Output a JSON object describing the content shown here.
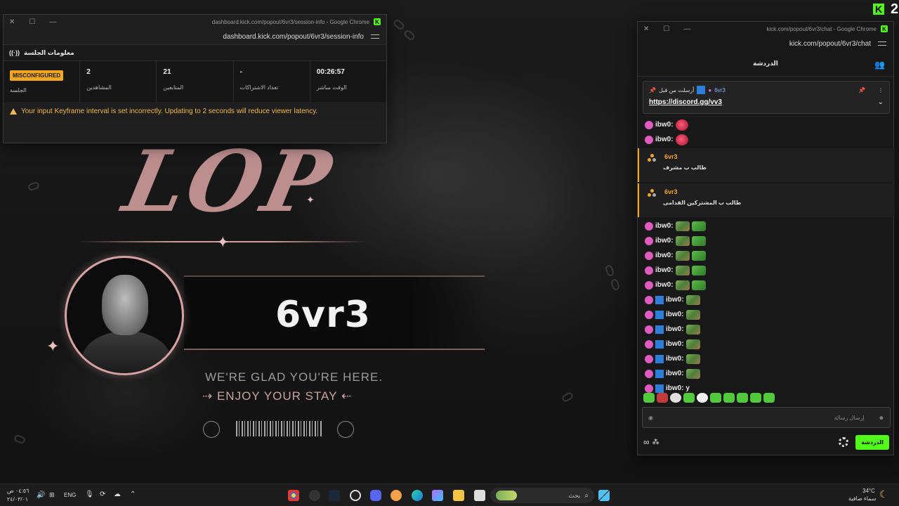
{
  "overlay": {
    "logo_text": "LOP",
    "streamer_name": "6vr3",
    "glad_text": "WE'RE GLAD YOU'RE HERE.",
    "enjoy_text": "ENJOY YOUR STAY"
  },
  "session_window": {
    "title": "dashboard.kick.com/popout/6vr3/session-info - Google Chrome",
    "url": "dashboard.kick.com/popout/6vr3/session-info",
    "header": "معلومات الجلسة",
    "stats": [
      {
        "value": "MISCONFIGURED",
        "label": "الجلسة",
        "is_badge": true
      },
      {
        "value": "2",
        "label": "المشاهدين"
      },
      {
        "value": "21",
        "label": "المتابعين"
      },
      {
        "value": "-",
        "label": "تعداد الاشتراكات"
      },
      {
        "value": "00:26:57",
        "label": "الوقت مباشر"
      }
    ],
    "warning": "Your input Keyframe interval is set incorrectly. Updating to 2 seconds will reduce viewer latency."
  },
  "chat_window": {
    "title": "kick.com/popout/6vr3/chat - Google Chrome",
    "url": "kick.com/popout/6vr3/chat",
    "header": "الدردشة",
    "pinned": {
      "from_label": "أرسلت من قبل",
      "author": "6vr3",
      "link": "https://discord.gg/vv3"
    },
    "messages": [
      {
        "type": "chat",
        "user": "ibw0:",
        "emotes": [
          "red"
        ],
        "badges": [
          "pink"
        ]
      },
      {
        "type": "chat",
        "user": "ibw0:",
        "emotes": [
          "red"
        ],
        "badges": [
          "pink"
        ]
      },
      {
        "type": "sub",
        "user": "6vr3",
        "text": "طالب ب مشرف"
      },
      {
        "type": "sub",
        "user": "6vr3",
        "text": "طالب ب المشتركين القدامى"
      },
      {
        "type": "chat",
        "user": "ibw0:",
        "emotes": [
          "mix",
          "green"
        ],
        "badges": [
          "pink"
        ]
      },
      {
        "type": "chat",
        "user": "ibw0:",
        "emotes": [
          "mix",
          "green"
        ],
        "badges": [
          "pink"
        ]
      },
      {
        "type": "chat",
        "user": "ibw0:",
        "emotes": [
          "mix",
          "green"
        ],
        "badges": [
          "pink"
        ]
      },
      {
        "type": "chat",
        "user": "ibw0:",
        "emotes": [
          "mix",
          "green"
        ],
        "badges": [
          "pink"
        ]
      },
      {
        "type": "chat",
        "user": "ibw0:",
        "emotes": [
          "mix",
          "green"
        ],
        "badges": [
          "pink"
        ]
      },
      {
        "type": "chat",
        "user": "ibw0:",
        "emotes": [
          "mix"
        ],
        "badges": [
          "pink",
          "blue"
        ]
      },
      {
        "type": "chat",
        "user": "ibw0:",
        "emotes": [
          "mix"
        ],
        "badges": [
          "pink",
          "blue"
        ]
      },
      {
        "type": "chat",
        "user": "ibw0:",
        "emotes": [
          "mix"
        ],
        "badges": [
          "pink",
          "blue"
        ]
      },
      {
        "type": "chat",
        "user": "ibw0:",
        "emotes": [
          "mix"
        ],
        "badges": [
          "pink",
          "blue"
        ]
      },
      {
        "type": "chat",
        "user": "ibw0:",
        "emotes": [
          "mix"
        ],
        "badges": [
          "pink",
          "blue"
        ]
      },
      {
        "type": "chat",
        "user": "ibw0:",
        "emotes": [
          "mix"
        ],
        "badges": [
          "pink",
          "blue"
        ]
      },
      {
        "type": "chat",
        "user": "ibw0: y",
        "emotes": [],
        "badges": [
          "pink",
          "blue"
        ]
      }
    ],
    "input_placeholder": "إرسال رسالة",
    "send_label": "الدردشة"
  },
  "top_right": {
    "viewer_count": "2"
  },
  "taskbar": {
    "time": "٠٤:٥٦ ص",
    "date": "٢٤/٠٣/٠١",
    "lang": "ENG",
    "search_placeholder": "بحث",
    "weather_temp": "34°C",
    "weather_desc": "سماء صافية"
  },
  "colors": {
    "kick_green": "#53fc18",
    "warning_orange": "#f5a623",
    "accent_pink": "#d6a3a3"
  }
}
